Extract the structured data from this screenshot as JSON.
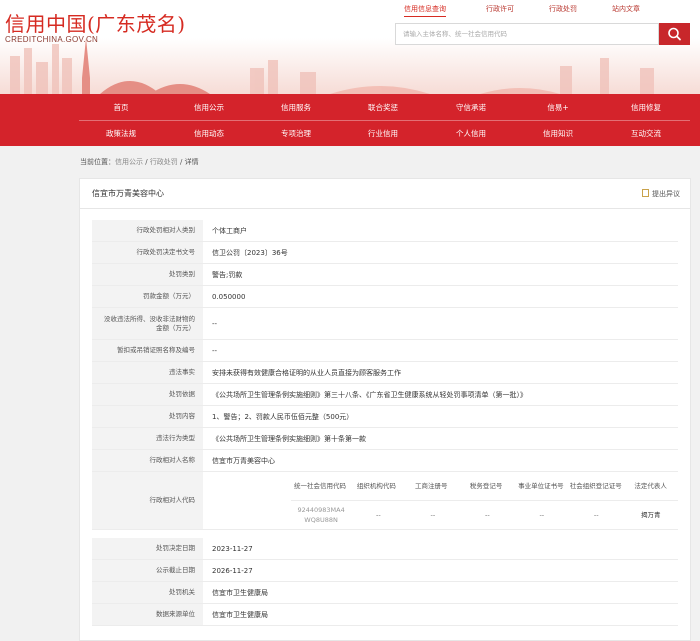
{
  "site": {
    "logo_title": "信用中国(广东茂名)",
    "logo_domain": "CREDITCHINA.GOV.CN",
    "top_tabs": [
      "信用信息查询",
      "行政许可",
      "行政处罚",
      "站内文章"
    ],
    "search_placeholder": "请输入主体名称、统一社会信用代码"
  },
  "nav": {
    "row1": [
      "首页",
      "信用公示",
      "信用服务",
      "联合奖惩",
      "守信承诺",
      "信易+",
      "信用修复"
    ],
    "row2": [
      "政策法规",
      "信用动态",
      "专项治理",
      "行业信用",
      "个人信用",
      "信用知识",
      "互动交流"
    ]
  },
  "breadcrumb": {
    "prefix": "当前位置：",
    "items": [
      "信用公示",
      "行政处罚",
      "详情"
    ],
    "sep": " / "
  },
  "detail": {
    "title": "信宜市万青美容中心",
    "objection": "提出异议",
    "rows": [
      {
        "label": "行政处罚相对人类别",
        "value": "个体工商户"
      },
      {
        "label": "行政处罚决定书文号",
        "value": "信卫公罚〔2023〕36号"
      },
      {
        "label": "处罚类别",
        "value": "警告;罚款"
      },
      {
        "label": "罚款金额（万元）",
        "value": "0.050000"
      },
      {
        "label": "没收违法所得、没收非法财物的金额（万元）",
        "value": "--"
      },
      {
        "label": "暂扣或吊销证照名称及编号",
        "value": "--"
      },
      {
        "label": "违法事实",
        "value": "安排未获得有效健康合格证明的从业人员直接为顾客服务工作"
      },
      {
        "label": "处罚依据",
        "value": "《公共场所卫生管理条例实施细则》第三十八条、《广东省卫生健康系统从轻处罚事项清单（第一批）》"
      },
      {
        "label": "处罚内容",
        "value": "1、警告；2、罚款人民币伍佰元整（500元）"
      },
      {
        "label": "违法行为类型",
        "value": "《公共场所卫生管理条例实施细则》第十条第一款"
      },
      {
        "label": "行政相对人名称",
        "value": "信宜市万青美容中心"
      },
      {
        "label": "行政相对人代码",
        "value": ""
      },
      {
        "label": "处罚决定日期",
        "value": "2023-11-27"
      },
      {
        "label": "公示截止日期",
        "value": "2026-11-27"
      },
      {
        "label": "处罚机关",
        "value": "信宜市卫生健康局"
      },
      {
        "label": "数据来源单位",
        "value": "信宜市卫生健康局"
      }
    ],
    "code_table": {
      "headers": [
        "统一社会信用代码",
        "组织机构代码",
        "工商注册号",
        "税务登记号",
        "事业单位证书号",
        "社会组织登记证号",
        "法定代表人"
      ],
      "values": [
        "92440983MA4WQ8U88N",
        "--",
        "--",
        "--",
        "--",
        "--",
        "揭万青"
      ]
    }
  }
}
